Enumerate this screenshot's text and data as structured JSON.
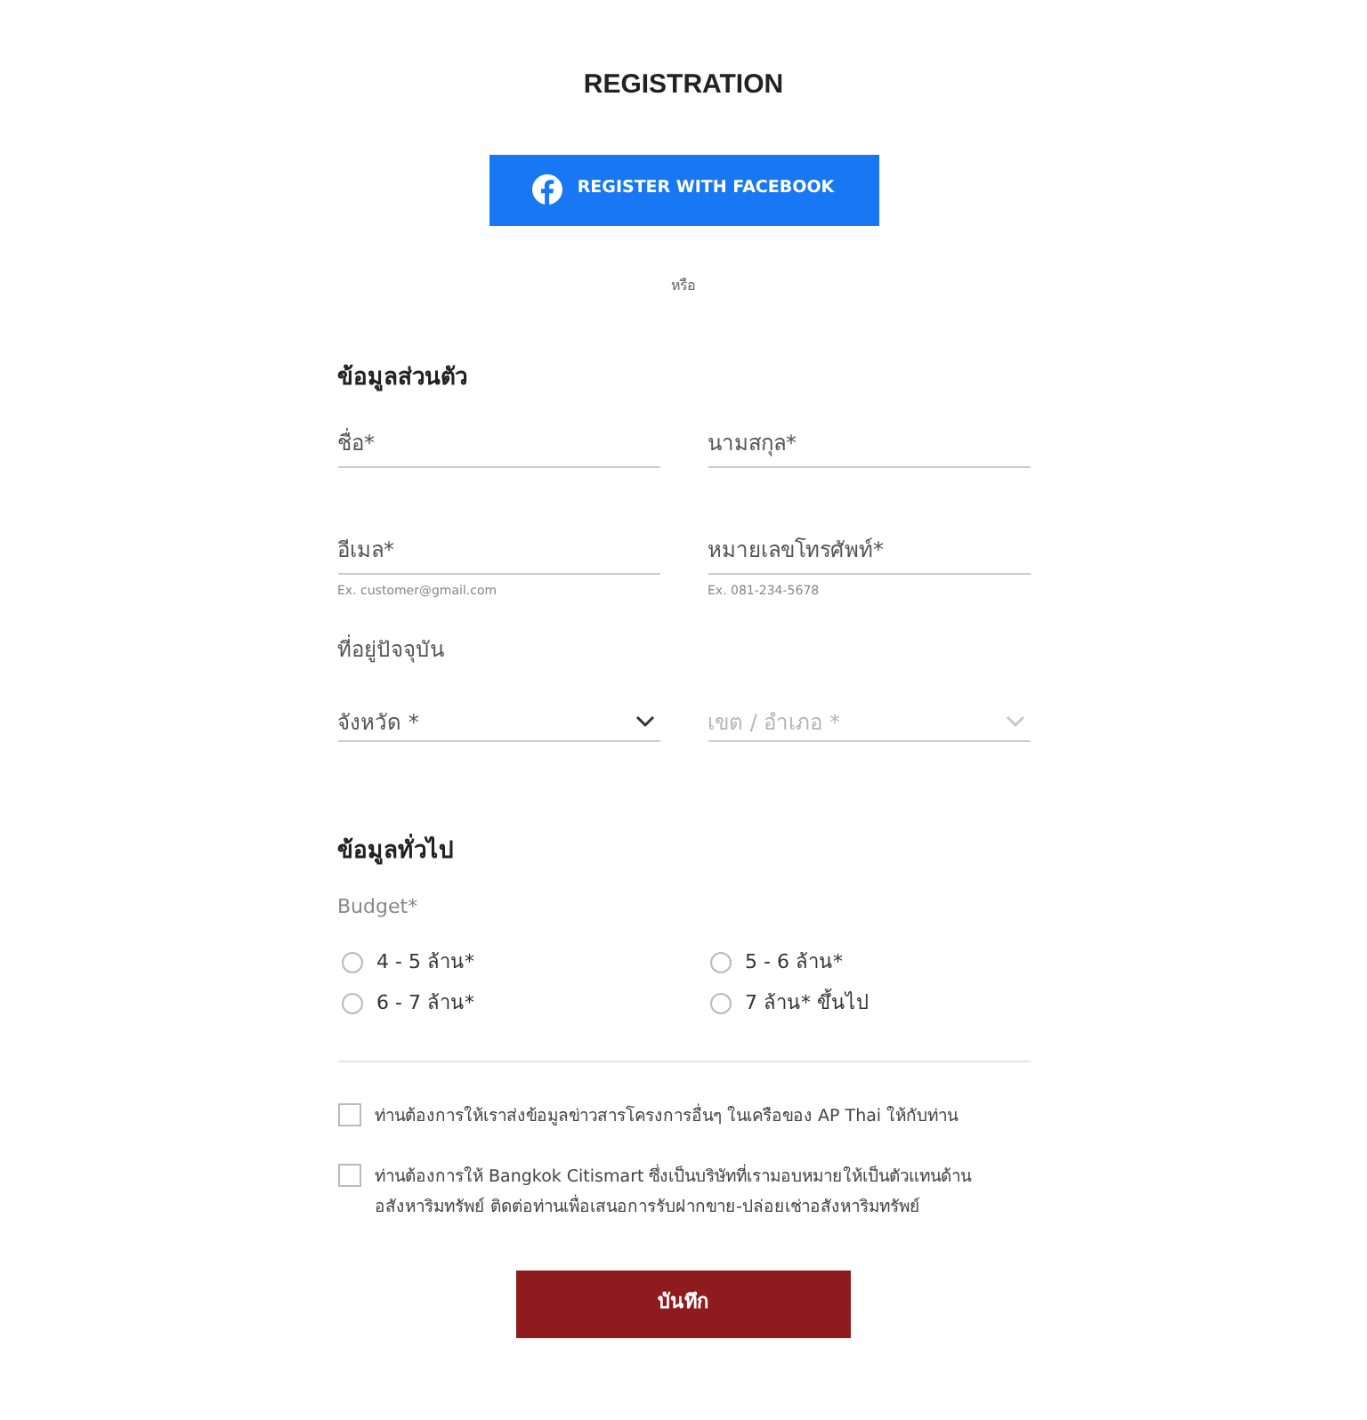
{
  "title": "REGISTRATION",
  "facebook_button": {
    "label": "REGISTER WITH FACEBOOK"
  },
  "separator": "หรือ",
  "personal": {
    "heading": "ข้อมูลส่วนตัว",
    "fields": [
      {
        "placeholder": "ชื่อ*"
      },
      {
        "placeholder": "นามสกุล*"
      },
      {
        "placeholder": "อีเมล*",
        "hint": "Ex. customer@gmail.com"
      },
      {
        "placeholder": "หมายเลขโทรศัพท์*",
        "hint": "Ex. 081-234-5678"
      }
    ],
    "address_label": "ที่อยู่ปัจจุบัน",
    "selects": [
      {
        "placeholder": "จังหวัด *",
        "disabled": false
      },
      {
        "placeholder": "เขต / อำเภอ *",
        "disabled": true
      }
    ]
  },
  "general": {
    "heading": "ข้อมูลทั่วไป",
    "budget_label": "Budget*",
    "options": [
      {
        "label": "4 - 5 ล้าน*",
        "selected": false
      },
      {
        "label": "5 - 6 ล้าน*",
        "selected": false
      },
      {
        "label": "6 - 7 ล้าน*",
        "selected": false
      },
      {
        "label": "7 ล้าน* ขึ้นไป",
        "selected": false
      }
    ]
  },
  "consents": [
    {
      "label": "ท่านต้องการให้เราส่งข้อมูลข่าวสารโครงการอื่นๆ ในเครือของ AP Thai ให้กับท่าน",
      "checked": false
    },
    {
      "label": "ท่านต้องการให้ Bangkok Citismart ซึ่งเป็นบริษัทที่เรามอบหมายให้เป็นตัวแทนด้านอสังหาริมทรัพย์ ติดต่อท่านเพื่อเสนอการรับฝากขาย-ปล่อยเช่าอสังหาริมทรัพย์",
      "checked": false
    }
  ],
  "save_button": {
    "label": "บันทึก"
  }
}
